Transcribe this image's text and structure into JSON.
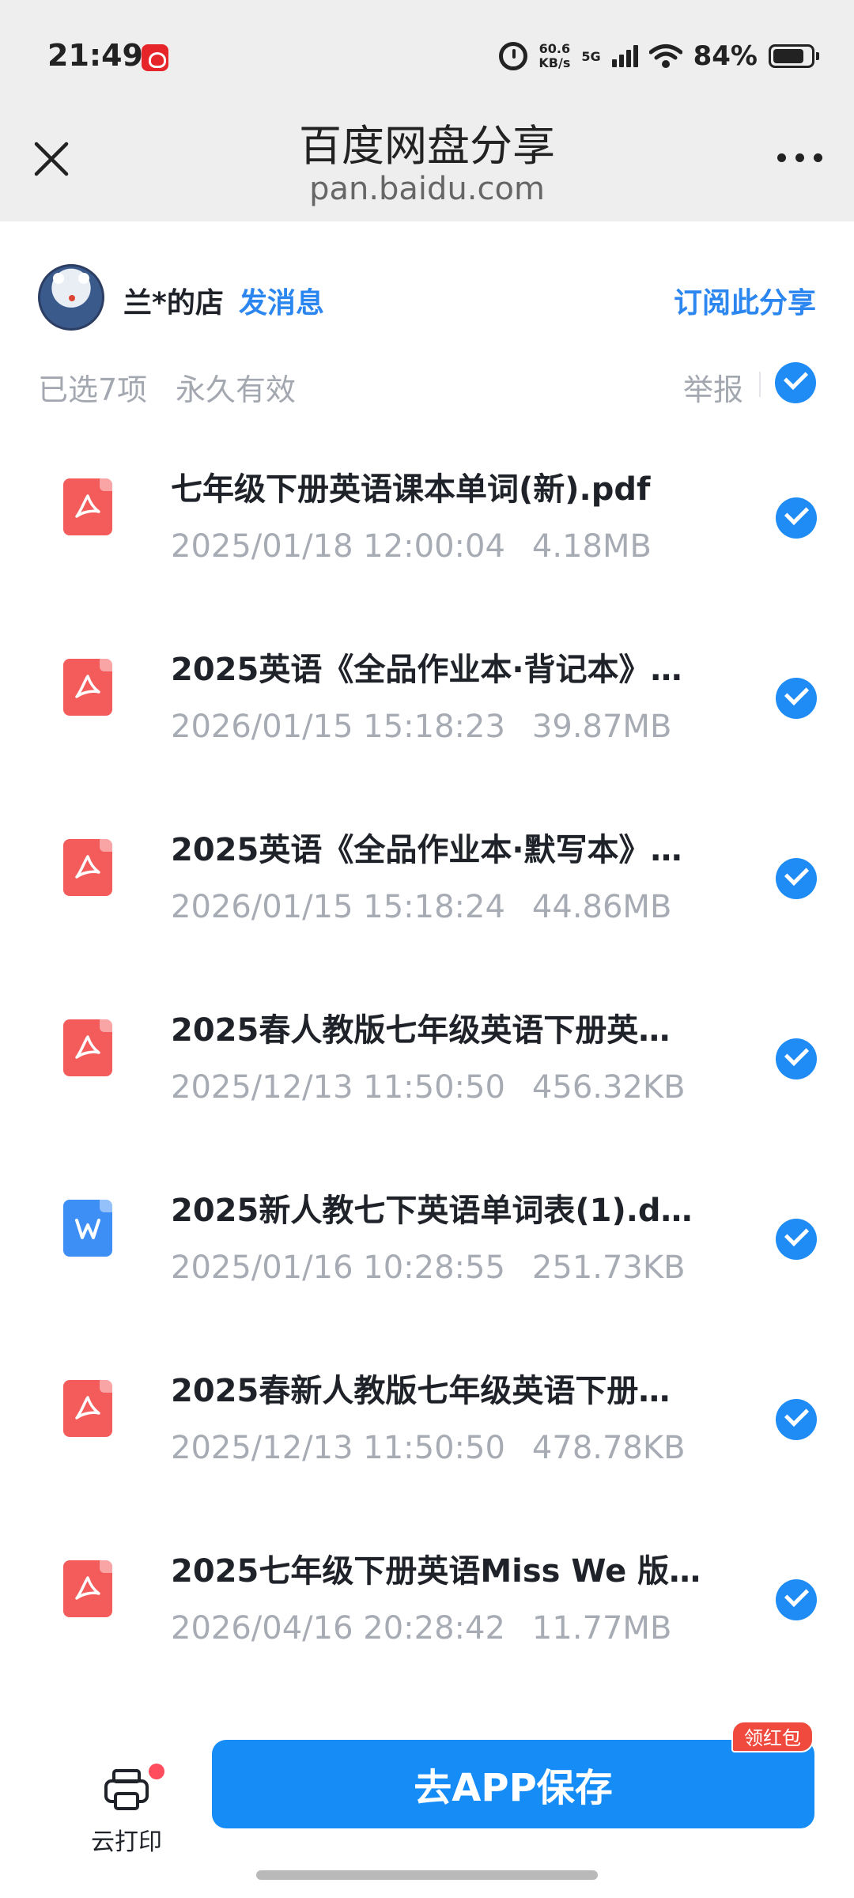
{
  "status_bar": {
    "time": "21:49",
    "net_speed_value": "60.6",
    "net_speed_unit": "KB/s",
    "network": "5G",
    "battery": "84%"
  },
  "nav": {
    "title": "百度网盘分享",
    "subtitle": "pan.baidu.com"
  },
  "owner": {
    "name": "兰*的店",
    "send_message": "发消息",
    "subscribe": "订阅此分享"
  },
  "selection": {
    "count_text": "已选7项",
    "validity": "永久有效",
    "report": "举报"
  },
  "files": [
    {
      "name": "七年级下册英语课本单词(新).pdf",
      "date": "2025/01/18 12:00:04",
      "size": "4.18MB",
      "type": "pdf"
    },
    {
      "name": "2025英语《全品作业本·背记本》…",
      "date": "2026/01/15 15:18:23",
      "size": "39.87MB",
      "type": "pdf"
    },
    {
      "name": "2025英语《全品作业本·默写本》…",
      "date": "2026/01/15 15:18:24",
      "size": "44.86MB",
      "type": "pdf"
    },
    {
      "name": "2025春人教版七年级英语下册英…",
      "date": "2025/12/13 11:50:50",
      "size": "456.32KB",
      "type": "pdf"
    },
    {
      "name": "2025新人教七下英语单词表(1).d…",
      "date": "2025/01/16 10:28:55",
      "size": "251.73KB",
      "type": "word"
    },
    {
      "name": "2025春新人教版七年级英语下册…",
      "date": "2025/12/13 11:50:50",
      "size": "478.78KB",
      "type": "pdf"
    },
    {
      "name": "2025七年级下册英语Miss We 版…",
      "date": "2026/04/16 20:28:42",
      "size": "11.77MB",
      "type": "pdf"
    }
  ],
  "bottom": {
    "print_label": "云打印",
    "save_label": "去APP保存",
    "red_packet": "领红包"
  },
  "colors": {
    "accent": "#168cf6",
    "pdf": "#f45b5b",
    "word": "#3d8ff5"
  }
}
